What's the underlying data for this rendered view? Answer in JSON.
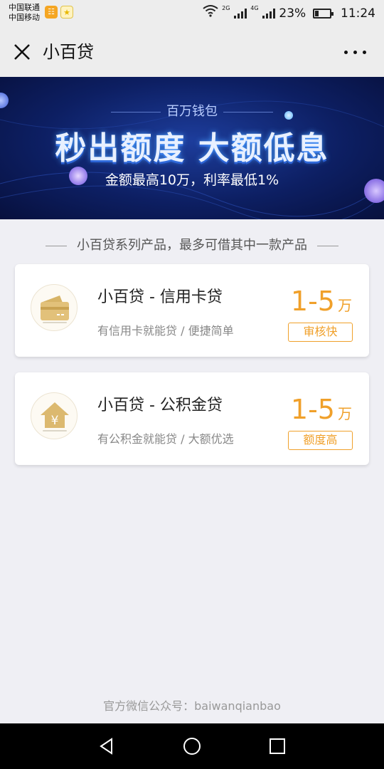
{
  "status_bar": {
    "carrier_1": "中国联通",
    "carrier_2": "中国移动",
    "net_1": "2G",
    "net_2": "4G",
    "battery": "23%",
    "battery_level": 0.23,
    "time": "11:24",
    "icons": [
      "app-notification-icon",
      "star-app-icon",
      "wifi-icon",
      "signal-icon",
      "battery-icon"
    ]
  },
  "nav": {
    "title": "小百贷",
    "icons": [
      "close-icon",
      "more-icon"
    ]
  },
  "banner": {
    "subtitle": "百万钱包",
    "headline": "秒出额度  大额低息",
    "description": "金额最高10万，利率最低1%"
  },
  "section": {
    "header": "小百贷系列产品，最多可借其中一款产品"
  },
  "products": [
    {
      "title": "小百贷 - 信用卡贷",
      "description": "有信用卡就能贷 / 便捷简单",
      "amount": "1-5",
      "unit": "万",
      "badge": "审核快",
      "icon": "credit-card-icon"
    },
    {
      "title": "小百贷 - 公积金贷",
      "description": "有公积金就能贷 / 大额优选",
      "amount": "1-5",
      "unit": "万",
      "badge": "额度高",
      "icon": "house-yuan-icon"
    }
  ],
  "footer": {
    "note": "官方微信公众号：baiwanqianbao"
  },
  "system_nav": {
    "icons": [
      "back-icon",
      "home-icon",
      "recents-icon"
    ]
  },
  "colors": {
    "accent": "#f0a02a",
    "background": "#efeff4",
    "banner_dark": "#0d1f63"
  }
}
